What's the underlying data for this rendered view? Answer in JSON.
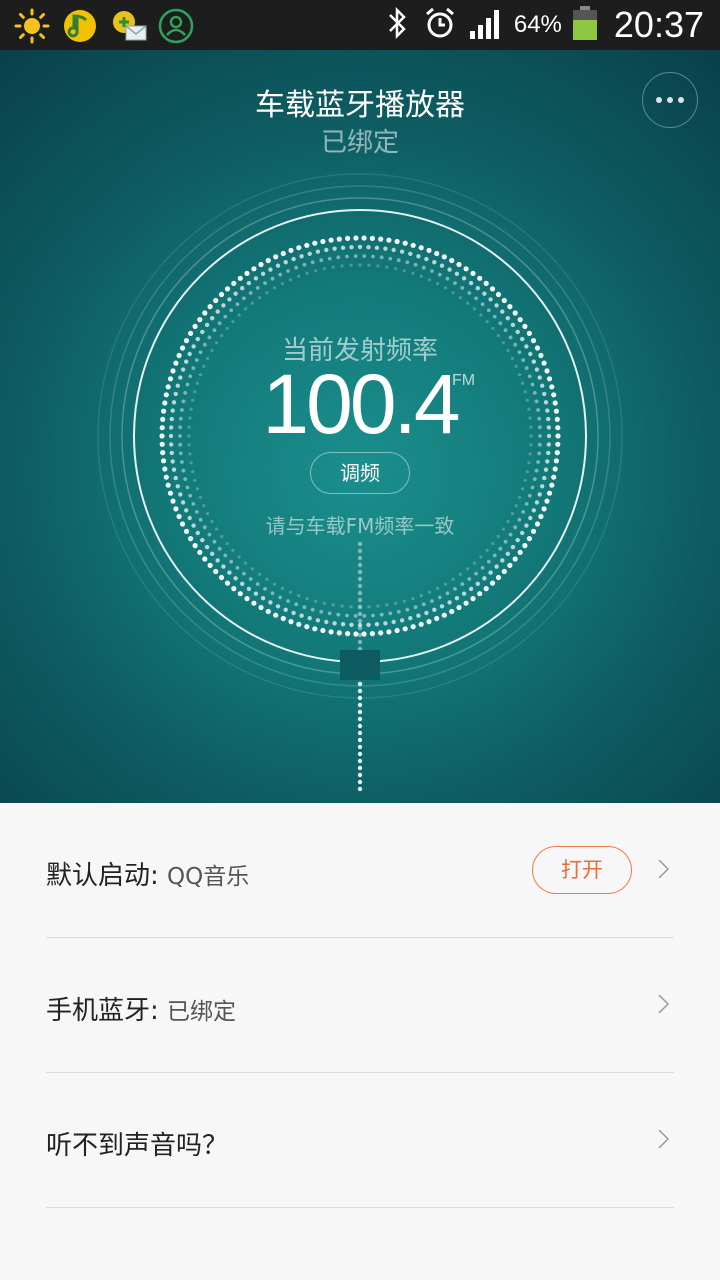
{
  "status_bar": {
    "left_icons": [
      "weather-sun-icon",
      "qq-music-icon",
      "messaging-icon",
      "contacts-icon"
    ],
    "right_icons": [
      "bluetooth-icon",
      "alarm-clock-icon",
      "signal-icon",
      "battery-icon"
    ],
    "battery": "64%",
    "time": "20:37"
  },
  "header": {
    "title": "车载蓝牙播放器",
    "subtitle": "已绑定",
    "more_icon": "more-dots-icon"
  },
  "dial": {
    "label": "当前发射频率",
    "frequency": "100.4",
    "unit": "FM",
    "tune_button": "调频",
    "hint": "请与车载FM频率一致"
  },
  "settings": [
    {
      "label": "默认启动:",
      "value": "QQ音乐",
      "button": "打开"
    },
    {
      "label": "手机蓝牙:",
      "value": "已绑定"
    },
    {
      "label": "听不到声音吗？",
      "value": ""
    }
  ],
  "colors": {
    "status_bar_bg": "#1d1d1d",
    "hero_teal": "#137a7a",
    "accent_orange": "#f0693a",
    "list_bg": "#f7f7f7"
  }
}
